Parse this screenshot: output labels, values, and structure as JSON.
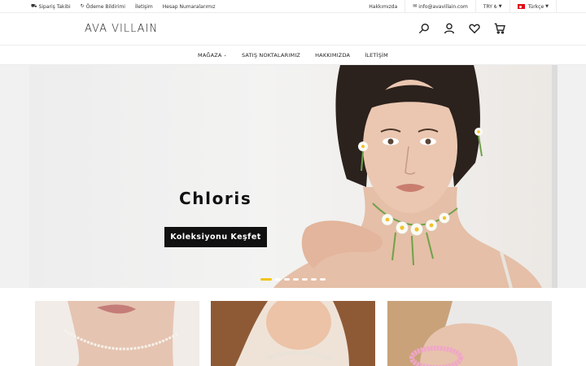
{
  "topbar": {
    "left_links": [
      {
        "label": "Sipariş Takibi",
        "icon": "truck-icon"
      },
      {
        "label": "Ödeme Bildirimi",
        "icon": "refresh-icon"
      },
      {
        "label": "İletişim",
        "icon": ""
      },
      {
        "label": "Hesap Numaralarımız",
        "icon": ""
      }
    ],
    "about": "Hakkımızda",
    "email": "info@avavillain.com",
    "currency": "TRY ₺",
    "language": "Türkçe"
  },
  "header": {
    "logo": "AVA VILLAIN",
    "icons": [
      "search-icon",
      "user-icon",
      "heart-icon",
      "cart-icon"
    ]
  },
  "nav": {
    "items": [
      "MAĞAZA",
      "SATIŞ NOKTALARIMIZ",
      "HAKKIMIZDA",
      "İLETİŞİM"
    ]
  },
  "hero": {
    "title": "Chloris",
    "button": "Koleksiyonu Keşfet",
    "slide_count": 7,
    "active_slide": 1
  },
  "colors": {
    "accent": "#f0c419",
    "button_bg": "#111111",
    "flag": "#e30a17"
  }
}
